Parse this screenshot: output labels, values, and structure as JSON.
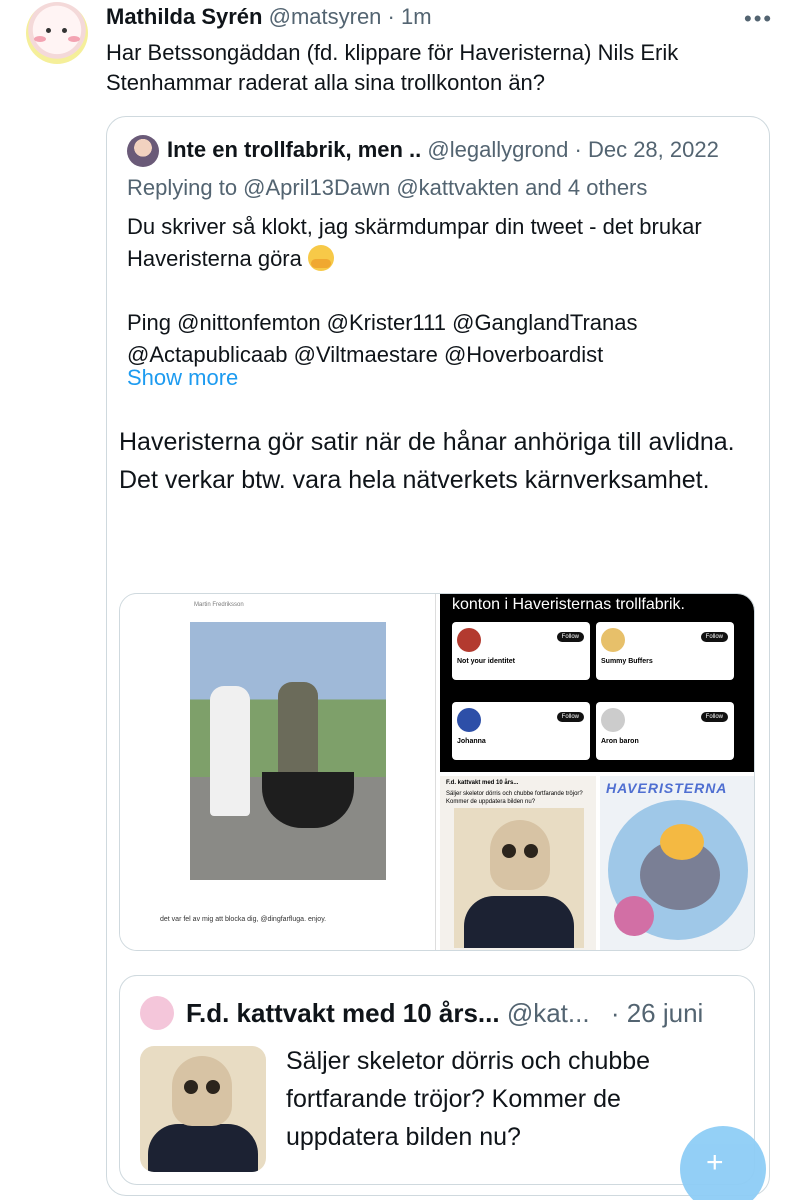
{
  "tweet": {
    "display_name": "Mathilda Syrén",
    "handle": "@matsyren",
    "time": "· 1m",
    "more_icon": "•••",
    "text": "Har Betssongäddan (fd. klippare för Haveristerna) Nils Erik Stenhammar raderat alla sina trollkonton än?"
  },
  "quoted": {
    "display_name": "Inte en trollfabrik, men ..",
    "handle": "@legallygrond",
    "date": "· Dec 28, 2022",
    "replying_to": "Replying to @April13Dawn @kattvakten and 4 others",
    "body_line1": "Du skriver så klokt, jag skärmdumpar din tweet - det brukar Haveristerna göra",
    "body_line2": "Ping @nittonfemton @Krister111 @GanglandTranas @Actapublicaab @Viltmaestare @Hoverboardist",
    "show_more": "Show more",
    "main_text": "Haveristerna gör satir när de hånar anhöriga till avlidna. Det verkar btw. vara hela nätverkets kärnverksamhet.",
    "media": {
      "img1_header": "Martin Fredriksson",
      "img1_caption": "det var fel av mig att blocka dig, @dingfarfluga. enjoy.",
      "img2_title": "konton i Haveristernas trollfabrik.",
      "profiles": [
        {
          "name": "Not your identitet",
          "follow": "Follow"
        },
        {
          "name": "Summy Buffers",
          "follow": "Follow"
        },
        {
          "name": "Johanna",
          "follow": "Follow"
        },
        {
          "name": "Aron baron",
          "follow": "Follow"
        }
      ],
      "img3_header": "F.d. kattvakt med 10 års...",
      "img3_text": "Säljer skeletor dörris och chubbe fortfarande tröjor? Kommer de uppdatera bilden nu?",
      "img4_logo": "HAVERISTERNA"
    },
    "nested": {
      "display_name": "F.d. kattvakt med 10 års...",
      "handle": "@kat...",
      "date": "· 26 juni",
      "text": "Säljer skeletor dörris och chubbe fortfarande tröjor? Kommer de uppdatera bilden nu?"
    }
  },
  "fab": {
    "icon": "compose-icon",
    "label": "+"
  }
}
